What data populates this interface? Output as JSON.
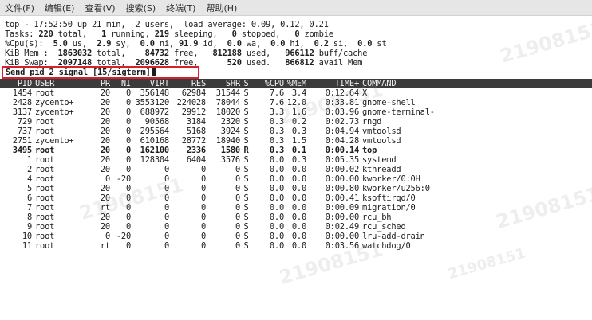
{
  "menubar": {
    "items": [
      "文件(F)",
      "编辑(E)",
      "查看(V)",
      "搜索(S)",
      "终端(T)",
      "帮助(H)"
    ]
  },
  "summary": {
    "line1": "top - 17:52:50 up 21 min,  2 users,  load average: 0.09, 0.12, 0.21",
    "tasks": [
      "Tasks: ",
      "220",
      " total,   ",
      "1",
      " running, ",
      "219",
      " sleeping,   ",
      "0",
      " stopped,   ",
      "0",
      " zombie"
    ],
    "cpu": [
      "%Cpu(s):  ",
      "5.0",
      " us,  ",
      "2.9",
      " sy,  ",
      "0.0",
      " ni, ",
      "91.9",
      " id,  ",
      "0.0",
      " wa,  ",
      "0.0",
      " hi,  ",
      "0.2",
      " si,  ",
      "0.0",
      " st"
    ],
    "mem": [
      "KiB Mem :  ",
      "1863032",
      " total,    ",
      "84732",
      " free,   ",
      "812188",
      " used,   ",
      "966112",
      " buff/cache"
    ],
    "swap": [
      "KiB Swap:  ",
      "2097148",
      " total,  ",
      "2096628",
      " free,      ",
      "520",
      " used.   ",
      "866812",
      " avail Mem"
    ]
  },
  "prompt": {
    "text": "Send pid 2 signal [15/sigterm]"
  },
  "table": {
    "headers": [
      "PID",
      "USER",
      "PR",
      "NI",
      "VIRT",
      "RES",
      "SHR",
      "S",
      "%CPU",
      "%MEM",
      "TIME+",
      "COMMAND"
    ],
    "rows": [
      [
        "1454",
        "root",
        "20",
        "0",
        "356148",
        "62984",
        "31544",
        "S",
        "7.6",
        "3.4",
        "0:12.64",
        "X"
      ],
      [
        "2428",
        "zycento+",
        "20",
        "0",
        "3553120",
        "224028",
        "78044",
        "S",
        "7.6",
        "12.0",
        "0:33.81",
        "gnome-shell"
      ],
      [
        "3137",
        "zycento+",
        "20",
        "0",
        "688972",
        "29912",
        "18020",
        "S",
        "3.3",
        "1.6",
        "0:03.96",
        "gnome-terminal-"
      ],
      [
        "729",
        "root",
        "20",
        "0",
        "90568",
        "3184",
        "2320",
        "S",
        "0.3",
        "0.2",
        "0:02.73",
        "rngd"
      ],
      [
        "737",
        "root",
        "20",
        "0",
        "295564",
        "5168",
        "3924",
        "S",
        "0.3",
        "0.3",
        "0:04.94",
        "vmtoolsd"
      ],
      [
        "2751",
        "zycento+",
        "20",
        "0",
        "610168",
        "28772",
        "18940",
        "S",
        "0.3",
        "1.5",
        "0:04.28",
        "vmtoolsd"
      ],
      [
        "3495",
        "root",
        "20",
        "0",
        "162100",
        "2336",
        "1580",
        "R",
        "0.3",
        "0.1",
        "0:00.14",
        "top"
      ],
      [
        "1",
        "root",
        "20",
        "0",
        "128304",
        "6404",
        "3576",
        "S",
        "0.0",
        "0.3",
        "0:05.35",
        "systemd"
      ],
      [
        "2",
        "root",
        "20",
        "0",
        "0",
        "0",
        "0",
        "S",
        "0.0",
        "0.0",
        "0:00.02",
        "kthreadd"
      ],
      [
        "4",
        "root",
        "0",
        "-20",
        "0",
        "0",
        "0",
        "S",
        "0.0",
        "0.0",
        "0:00.00",
        "kworker/0:0H"
      ],
      [
        "5",
        "root",
        "20",
        "0",
        "0",
        "0",
        "0",
        "S",
        "0.0",
        "0.0",
        "0:00.80",
        "kworker/u256:0"
      ],
      [
        "6",
        "root",
        "20",
        "0",
        "0",
        "0",
        "0",
        "S",
        "0.0",
        "0.0",
        "0:00.41",
        "ksoftirqd/0"
      ],
      [
        "7",
        "root",
        "rt",
        "0",
        "0",
        "0",
        "0",
        "S",
        "0.0",
        "0.0",
        "0:00.09",
        "migration/0"
      ],
      [
        "8",
        "root",
        "20",
        "0",
        "0",
        "0",
        "0",
        "S",
        "0.0",
        "0.0",
        "0:00.00",
        "rcu_bh"
      ],
      [
        "9",
        "root",
        "20",
        "0",
        "0",
        "0",
        "0",
        "S",
        "0.0",
        "0.0",
        "0:02.49",
        "rcu_sched"
      ],
      [
        "10",
        "root",
        "0",
        "-20",
        "0",
        "0",
        "0",
        "S",
        "0.0",
        "0.0",
        "0:00.00",
        "lru-add-drain"
      ],
      [
        "11",
        "root",
        "rt",
        "0",
        "0",
        "0",
        "0",
        "S",
        "0.0",
        "0.0",
        "0:03.56",
        "watchdog/0"
      ]
    ],
    "bold_row_index": 6
  },
  "watermark": {
    "text": "21908151"
  },
  "colors": {
    "menubar_bg": "#e6e6e6",
    "header_bg": "#3b3b3b",
    "prompt_box": "#d4212c",
    "terminal_bg": "#ffffff",
    "terminal_fg": "#1d1d1d"
  }
}
